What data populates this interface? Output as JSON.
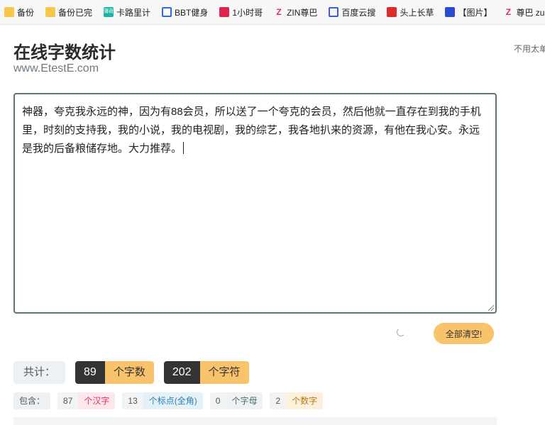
{
  "bookmarks": [
    {
      "label": "备份",
      "icon": "folder-icon"
    },
    {
      "label": "备份已完",
      "icon": "folder-icon"
    },
    {
      "label": "卡路里计",
      "icon": "kaluli-icon"
    },
    {
      "label": "BBT健身",
      "icon": "bbt-icon"
    },
    {
      "label": "1小时哥",
      "icon": "red-circle-icon"
    },
    {
      "label": "ZIN尊巴",
      "icon": "zin-icon"
    },
    {
      "label": "百度云搜",
      "icon": "baidu-cloud-icon"
    },
    {
      "label": "头上长草",
      "icon": "toutiao-icon"
    },
    {
      "label": "【图片】",
      "icon": "paw-icon"
    },
    {
      "label": "尊巴 zu",
      "icon": "zin-icon"
    }
  ],
  "header": {
    "title": "在线字数统计",
    "subtitle": "www.EtestE.com",
    "side_note": "不用太单"
  },
  "editor": {
    "text": "神器，夸克我永远的神，因为有88会员，所以送了一个夸克的会员，然后他就一直存在到我的手机里，时刻的支持我，我的小说，我的电视剧，我的综艺，我各地扒来的资源，有他在我心安。永远是我的后备粮储存地。大力推荐。"
  },
  "actions": {
    "clear_label": "全部清空!"
  },
  "totals": {
    "label": "共计：",
    "char_count": "89",
    "char_unit": "个字数",
    "symbol_count": "202",
    "symbol_unit": "个字符"
  },
  "breakdown": {
    "label": "包含：",
    "han_count": "87",
    "han_unit": "个汉字",
    "punct_count": "13",
    "punct_unit": "个标点(全角)",
    "letter_count": "0",
    "letter_unit": "个字母",
    "digit_count": "2",
    "digit_unit": "个数字"
  },
  "colors": {
    "accent": "#f8c36a",
    "dark": "#333333",
    "editor_border": "#5b7570"
  }
}
